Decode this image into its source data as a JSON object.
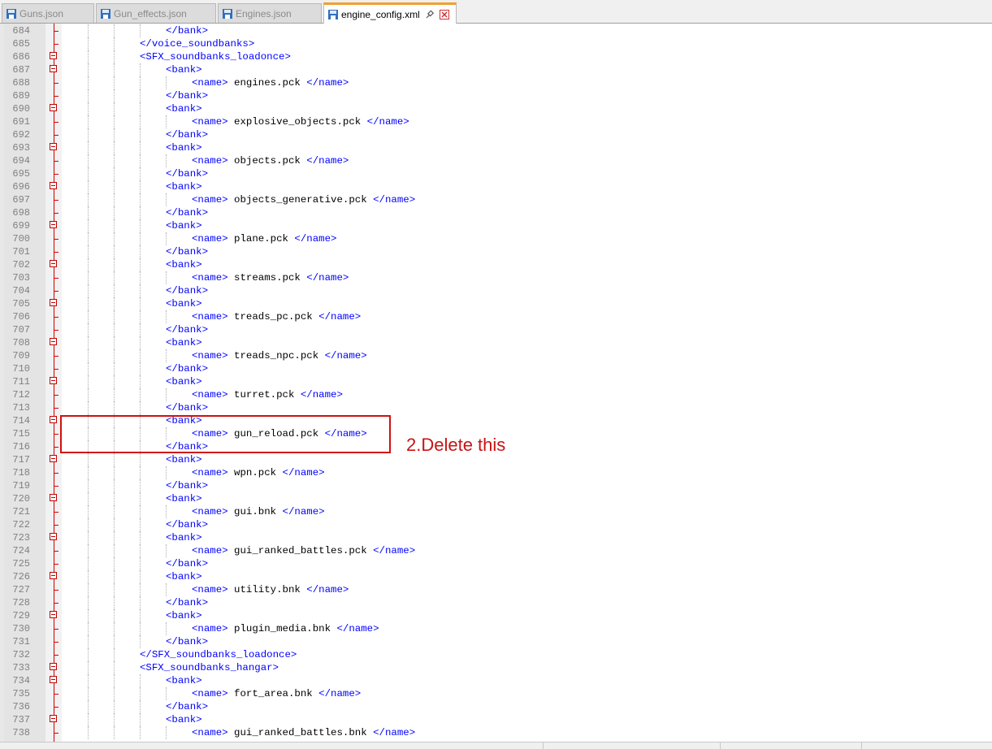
{
  "tabs": [
    {
      "label": "Guns.json",
      "active": false
    },
    {
      "label": "Gun_effects.json",
      "active": false
    },
    {
      "label": "Engines.json",
      "active": false
    },
    {
      "label": "engine_config.xml",
      "active": true
    }
  ],
  "annotation": "2.Delete this",
  "colors": {
    "tag": "#0000ff",
    "accent": "#f0a030",
    "annotation": "#c81414"
  },
  "icons": {
    "file": "floppy-disk-icon",
    "pin": "pin-icon",
    "close": "close-icon",
    "fold": "fold-minus-icon"
  },
  "lines": [
    {
      "num": "684",
      "indent": 4,
      "parts": [
        [
          "t",
          "</bank>"
        ]
      ]
    },
    {
      "num": "685",
      "indent": 3,
      "parts": [
        [
          "t",
          "</voice_soundbanks>"
        ]
      ]
    },
    {
      "num": "686",
      "indent": 3,
      "fold": true,
      "parts": [
        [
          "t",
          "<SFX_soundbanks_loadonce>"
        ]
      ]
    },
    {
      "num": "687",
      "indent": 4,
      "fold": true,
      "parts": [
        [
          "t",
          "<bank>"
        ]
      ]
    },
    {
      "num": "688",
      "indent": 5,
      "parts": [
        [
          "t",
          "<name>"
        ],
        [
          "x",
          " engines.pck "
        ],
        [
          "t",
          "</name>"
        ]
      ]
    },
    {
      "num": "689",
      "indent": 4,
      "parts": [
        [
          "t",
          "</bank>"
        ]
      ]
    },
    {
      "num": "690",
      "indent": 4,
      "fold": true,
      "parts": [
        [
          "t",
          "<bank>"
        ]
      ]
    },
    {
      "num": "691",
      "indent": 5,
      "parts": [
        [
          "t",
          "<name>"
        ],
        [
          "x",
          " explosive_objects.pck "
        ],
        [
          "t",
          "</name>"
        ]
      ]
    },
    {
      "num": "692",
      "indent": 4,
      "parts": [
        [
          "t",
          "</bank>"
        ]
      ]
    },
    {
      "num": "693",
      "indent": 4,
      "fold": true,
      "parts": [
        [
          "t",
          "<bank>"
        ]
      ]
    },
    {
      "num": "694",
      "indent": 5,
      "parts": [
        [
          "t",
          "<name>"
        ],
        [
          "x",
          " objects.pck "
        ],
        [
          "t",
          "</name>"
        ]
      ]
    },
    {
      "num": "695",
      "indent": 4,
      "parts": [
        [
          "t",
          "</bank>"
        ]
      ]
    },
    {
      "num": "696",
      "indent": 4,
      "fold": true,
      "parts": [
        [
          "t",
          "<bank>"
        ]
      ]
    },
    {
      "num": "697",
      "indent": 5,
      "parts": [
        [
          "t",
          "<name>"
        ],
        [
          "x",
          " objects_generative.pck "
        ],
        [
          "t",
          "</name>"
        ]
      ]
    },
    {
      "num": "698",
      "indent": 4,
      "parts": [
        [
          "t",
          "</bank>"
        ]
      ]
    },
    {
      "num": "699",
      "indent": 4,
      "fold": true,
      "parts": [
        [
          "t",
          "<bank>"
        ]
      ]
    },
    {
      "num": "700",
      "indent": 5,
      "parts": [
        [
          "t",
          "<name>"
        ],
        [
          "x",
          " plane.pck "
        ],
        [
          "t",
          "</name>"
        ]
      ]
    },
    {
      "num": "701",
      "indent": 4,
      "parts": [
        [
          "t",
          "</bank>"
        ]
      ]
    },
    {
      "num": "702",
      "indent": 4,
      "fold": true,
      "parts": [
        [
          "t",
          "<bank>"
        ]
      ]
    },
    {
      "num": "703",
      "indent": 5,
      "parts": [
        [
          "t",
          "<name>"
        ],
        [
          "x",
          " streams.pck "
        ],
        [
          "t",
          "</name>"
        ]
      ]
    },
    {
      "num": "704",
      "indent": 4,
      "parts": [
        [
          "t",
          "</bank>"
        ]
      ]
    },
    {
      "num": "705",
      "indent": 4,
      "fold": true,
      "parts": [
        [
          "t",
          "<bank>"
        ]
      ]
    },
    {
      "num": "706",
      "indent": 5,
      "parts": [
        [
          "t",
          "<name>"
        ],
        [
          "x",
          " treads_pc.pck "
        ],
        [
          "t",
          "</name>"
        ]
      ]
    },
    {
      "num": "707",
      "indent": 4,
      "parts": [
        [
          "t",
          "</bank>"
        ]
      ]
    },
    {
      "num": "708",
      "indent": 4,
      "fold": true,
      "parts": [
        [
          "t",
          "<bank>"
        ]
      ]
    },
    {
      "num": "709",
      "indent": 5,
      "parts": [
        [
          "t",
          "<name>"
        ],
        [
          "x",
          " treads_npc.pck "
        ],
        [
          "t",
          "</name>"
        ]
      ]
    },
    {
      "num": "710",
      "indent": 4,
      "parts": [
        [
          "t",
          "</bank>"
        ]
      ]
    },
    {
      "num": "711",
      "indent": 4,
      "fold": true,
      "parts": [
        [
          "t",
          "<bank>"
        ]
      ]
    },
    {
      "num": "712",
      "indent": 5,
      "parts": [
        [
          "t",
          "<name>"
        ],
        [
          "x",
          " turret.pck "
        ],
        [
          "t",
          "</name>"
        ]
      ]
    },
    {
      "num": "713",
      "indent": 4,
      "parts": [
        [
          "t",
          "</bank>"
        ]
      ]
    },
    {
      "num": "714",
      "indent": 4,
      "fold": true,
      "parts": [
        [
          "t",
          "<bank>"
        ]
      ]
    },
    {
      "num": "715",
      "indent": 5,
      "parts": [
        [
          "t",
          "<name>"
        ],
        [
          "x",
          " gun_reload.pck "
        ],
        [
          "t",
          "</name>"
        ]
      ]
    },
    {
      "num": "716",
      "indent": 4,
      "parts": [
        [
          "t",
          "</bank>"
        ]
      ]
    },
    {
      "num": "717",
      "indent": 4,
      "fold": true,
      "parts": [
        [
          "t",
          "<bank>"
        ]
      ]
    },
    {
      "num": "718",
      "indent": 5,
      "parts": [
        [
          "t",
          "<name>"
        ],
        [
          "x",
          " wpn.pck "
        ],
        [
          "t",
          "</name>"
        ]
      ]
    },
    {
      "num": "719",
      "indent": 4,
      "parts": [
        [
          "t",
          "</bank>"
        ]
      ]
    },
    {
      "num": "720",
      "indent": 4,
      "fold": true,
      "parts": [
        [
          "t",
          "<bank>"
        ]
      ]
    },
    {
      "num": "721",
      "indent": 5,
      "parts": [
        [
          "t",
          "<name>"
        ],
        [
          "x",
          " gui.bnk "
        ],
        [
          "t",
          "</name>"
        ]
      ]
    },
    {
      "num": "722",
      "indent": 4,
      "parts": [
        [
          "t",
          "</bank>"
        ]
      ]
    },
    {
      "num": "723",
      "indent": 4,
      "fold": true,
      "parts": [
        [
          "t",
          "<bank>"
        ]
      ]
    },
    {
      "num": "724",
      "indent": 5,
      "parts": [
        [
          "t",
          "<name>"
        ],
        [
          "x",
          " gui_ranked_battles.pck "
        ],
        [
          "t",
          "</name>"
        ]
      ]
    },
    {
      "num": "725",
      "indent": 4,
      "parts": [
        [
          "t",
          "</bank>"
        ]
      ]
    },
    {
      "num": "726",
      "indent": 4,
      "fold": true,
      "parts": [
        [
          "t",
          "<bank>"
        ]
      ]
    },
    {
      "num": "727",
      "indent": 5,
      "parts": [
        [
          "t",
          "<name>"
        ],
        [
          "x",
          " utility.bnk "
        ],
        [
          "t",
          "</name>"
        ]
      ]
    },
    {
      "num": "728",
      "indent": 4,
      "parts": [
        [
          "t",
          "</bank>"
        ]
      ]
    },
    {
      "num": "729",
      "indent": 4,
      "fold": true,
      "parts": [
        [
          "t",
          "<bank>"
        ]
      ]
    },
    {
      "num": "730",
      "indent": 5,
      "parts": [
        [
          "t",
          "<name>"
        ],
        [
          "x",
          " plugin_media.bnk "
        ],
        [
          "t",
          "</name>"
        ]
      ]
    },
    {
      "num": "731",
      "indent": 4,
      "parts": [
        [
          "t",
          "</bank>"
        ]
      ]
    },
    {
      "num": "732",
      "indent": 3,
      "parts": [
        [
          "t",
          "</SFX_soundbanks_loadonce>"
        ]
      ]
    },
    {
      "num": "733",
      "indent": 3,
      "fold": true,
      "parts": [
        [
          "t",
          "<SFX_soundbanks_hangar>"
        ]
      ]
    },
    {
      "num": "734",
      "indent": 4,
      "fold": true,
      "parts": [
        [
          "t",
          "<bank>"
        ]
      ]
    },
    {
      "num": "735",
      "indent": 5,
      "parts": [
        [
          "t",
          "<name>"
        ],
        [
          "x",
          " fort_area.bnk "
        ],
        [
          "t",
          "</name>"
        ]
      ]
    },
    {
      "num": "736",
      "indent": 4,
      "parts": [
        [
          "t",
          "</bank>"
        ]
      ]
    },
    {
      "num": "737",
      "indent": 4,
      "fold": true,
      "parts": [
        [
          "t",
          "<bank>"
        ]
      ]
    },
    {
      "num": "738",
      "indent": 5,
      "parts": [
        [
          "t",
          "<name>"
        ],
        [
          "x",
          " gui_ranked_battles.bnk "
        ],
        [
          "t",
          "</name>"
        ]
      ]
    }
  ]
}
